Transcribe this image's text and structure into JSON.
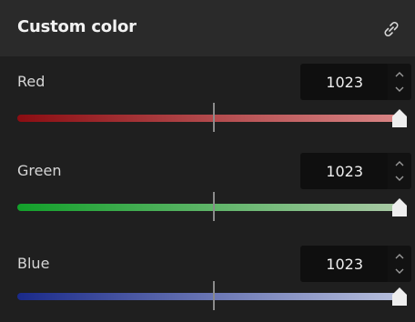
{
  "panel": {
    "title": "Custom color",
    "link_icon": "link-icon"
  },
  "channels": [
    {
      "label": "Red",
      "value": "1023",
      "max": 1023,
      "color_start": "#8b0d12",
      "color_end": "#d98585"
    },
    {
      "label": "Green",
      "value": "1023",
      "max": 1023,
      "color_start": "#12a02a",
      "color_end": "#a9c9a5"
    },
    {
      "label": "Blue",
      "value": "1023",
      "max": 1023,
      "color_start": "#1a2a8a",
      "color_end": "#b7bfdc"
    }
  ],
  "icons": {
    "spin_up": "chevron-up-icon",
    "spin_down": "chevron-down-icon",
    "thumb": "slider-thumb"
  }
}
